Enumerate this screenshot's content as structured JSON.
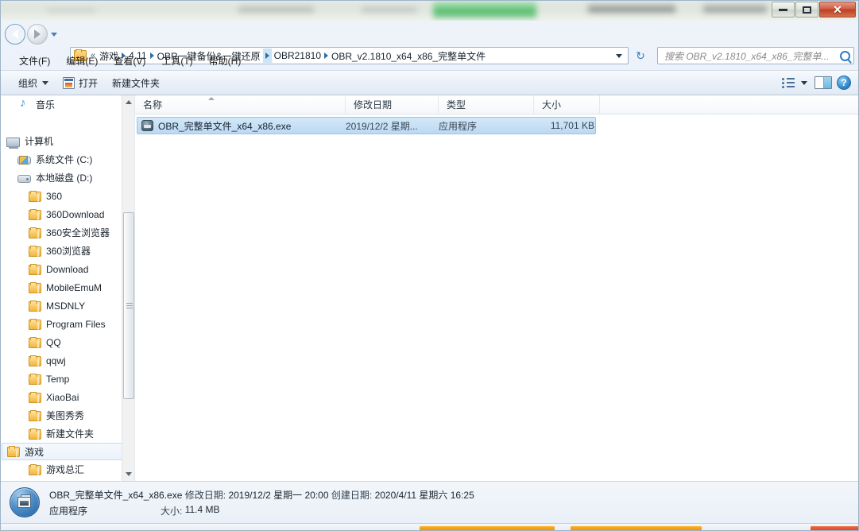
{
  "window": {
    "controls": {
      "minimize": "–",
      "maximize": "□",
      "close": "✕"
    }
  },
  "nav": {
    "back_icon": "back-arrow-icon",
    "forward_icon": "forward-arrow-icon",
    "recent_dropdown_icon": "chevron-down-icon",
    "refresh_icon": "↻"
  },
  "address": {
    "folder_icon": "folder-icon",
    "overflow": "«",
    "crumbs": [
      "游戏",
      "4.11",
      "OBR一键备份&一键还原",
      "OBR21810",
      "OBR_v2.1810_x64_x86_完整单文件"
    ],
    "dropdown_icon": "chevron-down-icon"
  },
  "search": {
    "placeholder": "搜索 OBR_v2.1810_x64_x86_完整单...",
    "icon": "search-icon"
  },
  "menu": {
    "items": [
      "文件(F)",
      "编辑(E)",
      "查看(V)",
      "工具(T)",
      "帮助(H)"
    ]
  },
  "toolbar": {
    "organize": "组织",
    "open": "打开",
    "new_folder": "新建文件夹",
    "view_icon": "list-view-icon",
    "preview_pane_icon": "preview-pane-icon",
    "help_icon": "?"
  },
  "sidebar": {
    "items": [
      {
        "label": "音乐",
        "icon": "music-icon",
        "indent": 1,
        "selected": false
      },
      {
        "label": "",
        "icon": "spacer",
        "indent": 0,
        "selected": false
      },
      {
        "label": "计算机",
        "icon": "computer-icon",
        "indent": 0,
        "selected": false
      },
      {
        "label": "系统文件 (C:)",
        "icon": "system-drive-icon",
        "indent": 1,
        "selected": false
      },
      {
        "label": "本地磁盘 (D:)",
        "icon": "drive-icon",
        "indent": 1,
        "selected": false
      },
      {
        "label": "360",
        "icon": "folder-icon",
        "indent": 2,
        "selected": false
      },
      {
        "label": "360Download",
        "icon": "folder-icon",
        "indent": 2,
        "selected": false
      },
      {
        "label": "360安全浏览器",
        "icon": "folder-icon",
        "indent": 2,
        "selected": false
      },
      {
        "label": "360浏览器",
        "icon": "folder-icon",
        "indent": 2,
        "selected": false
      },
      {
        "label": "Download",
        "icon": "folder-icon",
        "indent": 2,
        "selected": false
      },
      {
        "label": "MobileEmuM",
        "icon": "folder-icon",
        "indent": 2,
        "selected": false
      },
      {
        "label": "MSDNLY",
        "icon": "folder-icon",
        "indent": 2,
        "selected": false
      },
      {
        "label": "Program Files",
        "icon": "folder-icon",
        "indent": 2,
        "selected": false
      },
      {
        "label": "QQ",
        "icon": "folder-icon",
        "indent": 2,
        "selected": false
      },
      {
        "label": "qqwj",
        "icon": "folder-icon",
        "indent": 2,
        "selected": false
      },
      {
        "label": "Temp",
        "icon": "folder-icon",
        "indent": 2,
        "selected": false
      },
      {
        "label": "XiaoBai",
        "icon": "folder-icon",
        "indent": 2,
        "selected": false
      },
      {
        "label": "美图秀秀",
        "icon": "folder-icon",
        "indent": 2,
        "selected": false
      },
      {
        "label": "新建文件夹",
        "icon": "folder-icon",
        "indent": 2,
        "selected": false
      },
      {
        "label": "游戏",
        "icon": "folder-icon",
        "indent": 2,
        "selected": true
      },
      {
        "label": "游戏总汇",
        "icon": "folder-icon",
        "indent": 2,
        "selected": false
      }
    ]
  },
  "filelist": {
    "columns": [
      "名称",
      "修改日期",
      "类型",
      "大小"
    ],
    "sorted_column": "名称",
    "rows": [
      {
        "name": "OBR_完整单文件_x64_x86.exe",
        "date": "2019/12/2 星期...",
        "type": "应用程序",
        "size": "11,701 KB",
        "icon": "exe-icon",
        "selected": true
      }
    ]
  },
  "details": {
    "icon": "application-icon",
    "filename": "OBR_完整单文件_x64_x86.exe",
    "modified_label": "修改日期:",
    "modified_value": "2019/12/2 星期一 20:00",
    "created_label": "创建日期:",
    "created_value": "2020/4/11 星期六 16:25",
    "type_value": "应用程序",
    "size_label": "大小:",
    "size_value": "11.4 MB"
  },
  "colors": {
    "selection_blue": "#bcd9f2",
    "crumb_highlight": "#cce4f7",
    "close_red": "#bb3f23",
    "folder_yellow": "#f2b63c"
  }
}
